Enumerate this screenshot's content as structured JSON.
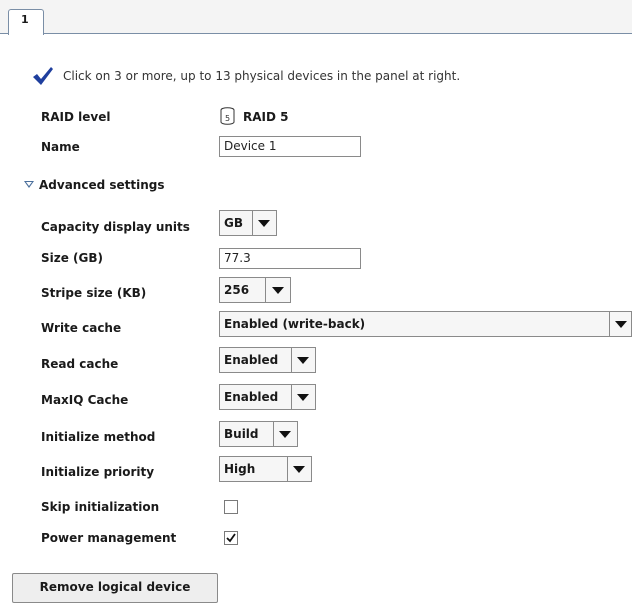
{
  "tab": {
    "label": "1"
  },
  "instruction": "Click on 3 or more, up to 13 physical devices in the panel at right.",
  "raid": {
    "label": "RAID level",
    "icon_digit": "5",
    "value": "RAID 5"
  },
  "name": {
    "label": "Name",
    "value": "Device 1"
  },
  "advanced": {
    "label": "Advanced settings",
    "expanded": true
  },
  "settings": {
    "capacity_units": {
      "label": "Capacity display units",
      "value": "GB"
    },
    "size": {
      "label": "Size (GB)",
      "value": "77.3"
    },
    "stripe_size": {
      "label": "Stripe size (KB)",
      "value": "256"
    },
    "write_cache": {
      "label": "Write cache",
      "value": "Enabled (write-back)"
    },
    "read_cache": {
      "label": "Read cache",
      "value": "Enabled"
    },
    "maxiq_cache": {
      "label": "MaxIQ Cache",
      "value": "Enabled"
    },
    "init_method": {
      "label": "Initialize method",
      "value": "Build"
    },
    "init_priority": {
      "label": "Initialize priority",
      "value": "High"
    },
    "skip_init": {
      "label": "Skip initialization",
      "checked": false
    },
    "power_mgmt": {
      "label": "Power management",
      "checked": true
    }
  },
  "remove_button": "Remove logical device",
  "colors": {
    "check_accent": "#1f3f9e",
    "tab_border": "#7a8ea6",
    "triangle": "#4a6f9c"
  }
}
